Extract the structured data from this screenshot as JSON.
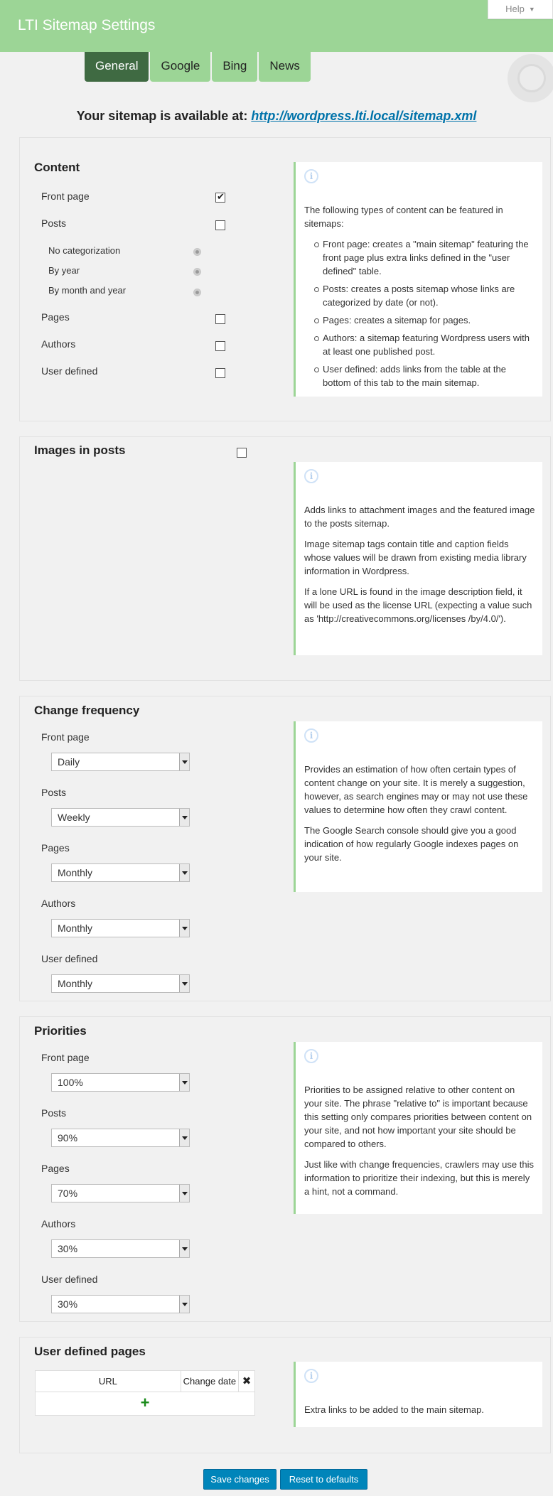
{
  "header": {
    "title": "LTI Sitemap Settings",
    "help_label": "Help"
  },
  "tabs": [
    {
      "label": "General",
      "active": true
    },
    {
      "label": "Google",
      "active": false
    },
    {
      "label": "Bing",
      "active": false
    },
    {
      "label": "News",
      "active": false
    }
  ],
  "sitemap": {
    "prefix": "Your sitemap is available at:",
    "url": "http://wordpress.lti.local/sitemap.xml"
  },
  "content": {
    "title": "Content",
    "front_page": {
      "label": "Front page",
      "checked": true
    },
    "posts": {
      "label": "Posts",
      "checked": false
    },
    "posts_options": [
      {
        "label": "No categorization",
        "selected": true
      },
      {
        "label": "By year",
        "selected": false
      },
      {
        "label": "By month and year",
        "selected": false
      }
    ],
    "pages": {
      "label": "Pages",
      "checked": false
    },
    "authors": {
      "label": "Authors",
      "checked": false
    },
    "user_defined": {
      "label": "User defined",
      "checked": false
    },
    "info": {
      "intro": "The following types of content can be featured in sitemaps:",
      "items": [
        "Front page: creates a \"main sitemap\" featuring the front page plus extra links defined in the \"user defined\" table.",
        "Posts: creates a posts sitemap whose links are categorized by date (or not).",
        "Pages: creates a sitemap for pages.",
        "Authors: a sitemap featuring Wordpress users with at least one published post.",
        "User defined: adds links from the table at the bottom of this tab to the main sitemap."
      ]
    }
  },
  "images": {
    "title": "Images in posts",
    "checked": false,
    "info": {
      "p1": "Adds links to attachment images and the featured image to the posts sitemap.",
      "p2": "Image sitemap tags contain title and caption fields whose values will be drawn from existing media library information in Wordpress.",
      "p3": "If a lone URL is found in the image description field, it will be used as the license URL (expecting a value such as 'http://creativecommons.org/licenses /by/4.0/')."
    }
  },
  "change_frequency": {
    "title": "Change frequency",
    "fields": [
      {
        "label": "Front page",
        "value": "Daily"
      },
      {
        "label": "Posts",
        "value": "Weekly"
      },
      {
        "label": "Pages",
        "value": "Monthly"
      },
      {
        "label": "Authors",
        "value": "Monthly"
      },
      {
        "label": "User defined",
        "value": "Monthly"
      }
    ],
    "info": {
      "p1": "Provides an estimation of how often certain types of content change on your site. It is merely a suggestion, however, as search engines may or may not use these values to determine how often they crawl content.",
      "p2": "The Google Search console should give you a good indication of how regularly Google indexes pages on your site."
    }
  },
  "priorities": {
    "title": "Priorities",
    "fields": [
      {
        "label": "Front page",
        "value": "100%"
      },
      {
        "label": "Posts",
        "value": "90%"
      },
      {
        "label": "Pages",
        "value": "70%"
      },
      {
        "label": "Authors",
        "value": "30%"
      },
      {
        "label": "User defined",
        "value": "30%"
      }
    ],
    "info": {
      "p1": "Priorities to be assigned relative to other content on your site. The phrase \"relative to\" is important because this setting only compares priorities between content on your site, and not how important your site should be compared to others.",
      "p2": "Just like with change frequencies, crawlers may use this information to prioritize their indexing, but this is merely a hint, not a command."
    }
  },
  "user_defined_pages": {
    "title": "User defined pages",
    "col_url": "URL",
    "col_date": "Change date",
    "remove_symbol": "✖",
    "add_symbol": "+",
    "info": "Extra links to be added to the main sitemap."
  },
  "buttons": {
    "save": "Save changes",
    "reset": "Reset to defaults"
  },
  "colors": {
    "header_green": "#9cd596",
    "active_tab": "#3f6a42",
    "button_blue": "#0085ba",
    "link_blue": "#0073aa"
  }
}
